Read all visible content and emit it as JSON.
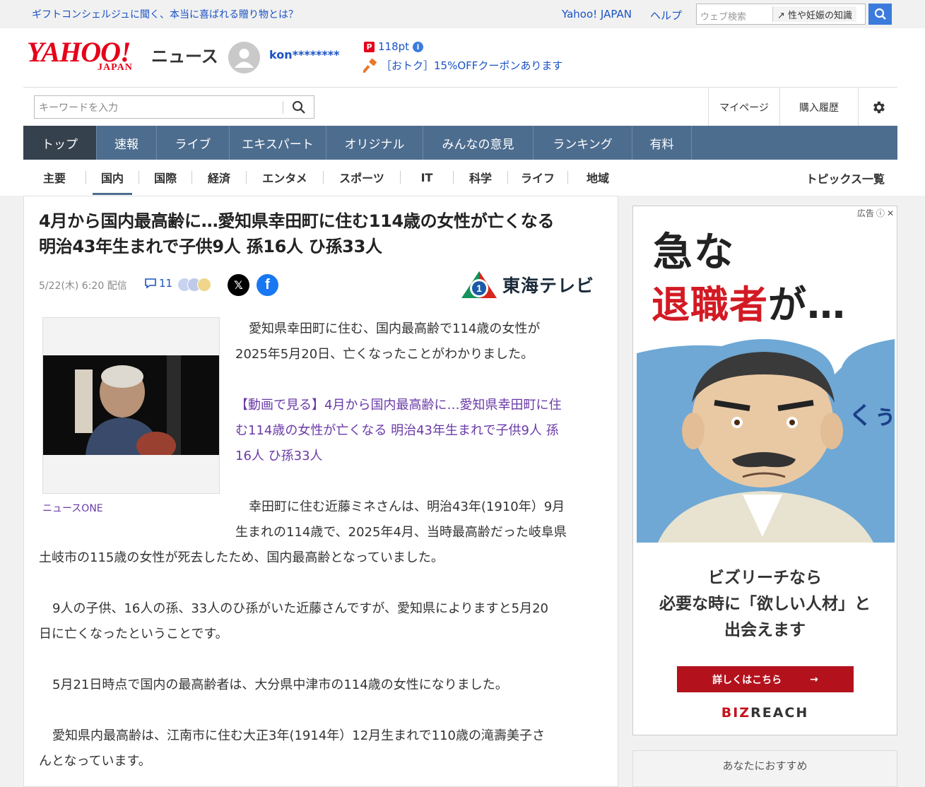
{
  "topbar": {
    "promo": "ギフトコンシェルジュに聞く、本当に喜ばれる贈り物とは？",
    "yahoo_japan": "Yahoo! JAPAN",
    "help": "ヘルプ",
    "search_placeholder": "ウェブ検索",
    "search_chip": "性や妊娠の知識"
  },
  "header": {
    "logo_yahoo": "YAHOO!",
    "logo_japan": "JAPAN",
    "logo_news": "ニュース",
    "username": "kon********",
    "points": "118pt",
    "coupon": "［おトク］15%OFFクーポンあります",
    "keyword_placeholder": "キーワードを入力",
    "mypage": "マイページ",
    "history": "購入履歴"
  },
  "global_nav": [
    {
      "label": "トップ",
      "active": true
    },
    {
      "label": "速報"
    },
    {
      "label": "ライブ"
    },
    {
      "label": "エキスパート"
    },
    {
      "label": "オリジナル"
    },
    {
      "label": "みんなの意見"
    },
    {
      "label": "ランキング"
    },
    {
      "label": "有料"
    }
  ],
  "sub_nav": {
    "items": [
      "主要",
      "国内",
      "国際",
      "経済",
      "エンタメ",
      "スポーツ",
      "IT",
      "科学",
      "ライフ",
      "地域"
    ],
    "active": "国内",
    "topics": "トピックス一覧"
  },
  "article": {
    "title_line1": "4月から国内最高齢に…愛知県幸田町に住む114歳の女性が亡くなる",
    "title_line2": "明治43年生まれで子供9人 孫16人 ひ孫33人",
    "date": "5/22(木) 6:20 配信",
    "comment_count": "11",
    "source": "東海テレビ",
    "photo_caption": "ニュースONE",
    "p1_line1": "愛知県幸田町に住む、国内最高齢で114歳の女性が",
    "p1_line2": "2025年5月20日、亡くなったことがわかりました。",
    "link_line1": "【動画で見る】4月から国内最高齢に…愛知県幸田町に住",
    "link_line2": "む114歳の女性が亡くなる 明治43年生まれで子供9人 孫",
    "link_line3": "16人 ひ孫33人",
    "p2_line1": "幸田町に住む近藤ミネさんは、明治43年(1910年）9月",
    "p2_line2": "生まれの114歳で、2025年4月、当時最高齢だった岐阜県",
    "p2_line3": "土岐市の115歳の女性が死去したため、国内最高齢となっていました。",
    "p3_line1": "9人の子供、16人の孫、33人のひ孫がいた近藤さんですが、愛知県によりますと5月20",
    "p3_line2": "日に亡くなったということです。",
    "p4": "5月21日時点で国内の最高齢者は、大分県中津市の114歳の女性になりました。",
    "p5_line1": "愛知県内最高齢は、江南市に住む大正3年(1914年）12月生まれで110歳の滝壽美子さ",
    "p5_line2": "んとなっています。"
  },
  "ad": {
    "label": "広告",
    "headline1": "急な",
    "headline2_red": "退職者",
    "headline2_black": "が…",
    "sfx": "くぅ…",
    "copy_line1": "ビズリーチなら",
    "copy_line2": "必要な時に「欲しい人材」と",
    "copy_line3": "出会えます",
    "button": "詳しくはこちら",
    "brand_red": "BIZ",
    "brand_black": "REACH"
  },
  "recommend": {
    "title": "あなたにおすすめ"
  },
  "colors": {
    "brand_red": "#e60019",
    "nav_bg": "#4d6d8f",
    "nav_active": "#36414e",
    "link_blue": "#1a52c4",
    "link_purple": "#6a3aa7"
  }
}
